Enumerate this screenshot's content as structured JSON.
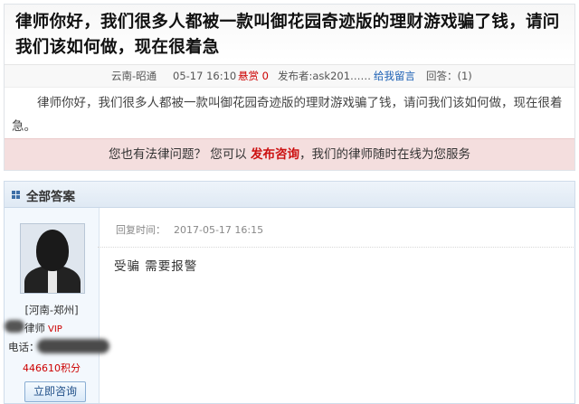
{
  "question": {
    "title": "律师你好，我们很多人都被一款叫御花园奇迹版的理财游戏骗了钱，请问我们该如何做，现在很着急",
    "meta": {
      "location": "云南-昭通",
      "time": "05-17 16:10",
      "bounty": "悬赏 0",
      "poster": "发布者:ask201……",
      "leave_message": "给我留言",
      "answers": "回答：(1)"
    },
    "body": "律师你好，我们很多人都被一款叫御花园奇迹版的理财游戏骗了钱，请问我们该如何做，现在很着急。"
  },
  "promo": {
    "prefix": "您也有法律问题？ 您可以",
    "highlight": "发布咨询",
    "suffix": "，我们的律师随时在线为您服务"
  },
  "answers_section": {
    "header": "全部答案",
    "lawyer": {
      "location": "[河南-郑州]",
      "role": "律师",
      "vip": "VIP",
      "phone_label": "电话：",
      "points": "446610积分",
      "consult_button": "立即咨询"
    },
    "answer": {
      "time_label": "回复时间：",
      "time": "2017-05-17 16:15",
      "text": "受骗  需要报警"
    }
  }
}
